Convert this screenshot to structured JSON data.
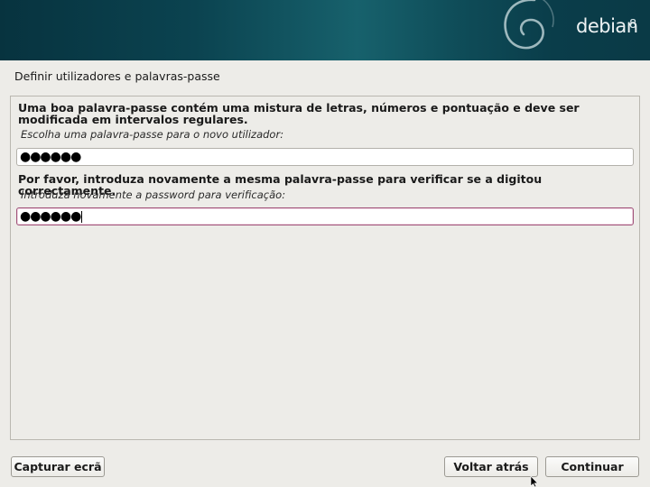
{
  "banner": {
    "brand": "debian",
    "version": "8",
    "logo_icon": "debian-swirl-icon"
  },
  "step": {
    "title": "Definir utilizadores e palavras-passe"
  },
  "password": {
    "description": "Uma boa palavra-passe contém uma mistura de letras, números e pontuação e deve ser modificada em intervalos regulares.",
    "prompt": "Escolha uma palavra-passe para o novo utilizador:",
    "masked_value": "●●●●●●"
  },
  "verify": {
    "description": "Por favor, introduza novamente a mesma palavra-passe para verificar se a digitou correctamente.",
    "prompt": "Introduza novamente a password para verificação:",
    "masked_value": "●●●●●●"
  },
  "buttons": {
    "screenshot": "Capturar ecrã",
    "back": "Voltar atrás",
    "continue": "Continuar"
  },
  "colors": {
    "banner_dark": "#07333f",
    "banner_mid": "#17616c",
    "focus_border": "#a0547a",
    "background": "#edece8"
  }
}
